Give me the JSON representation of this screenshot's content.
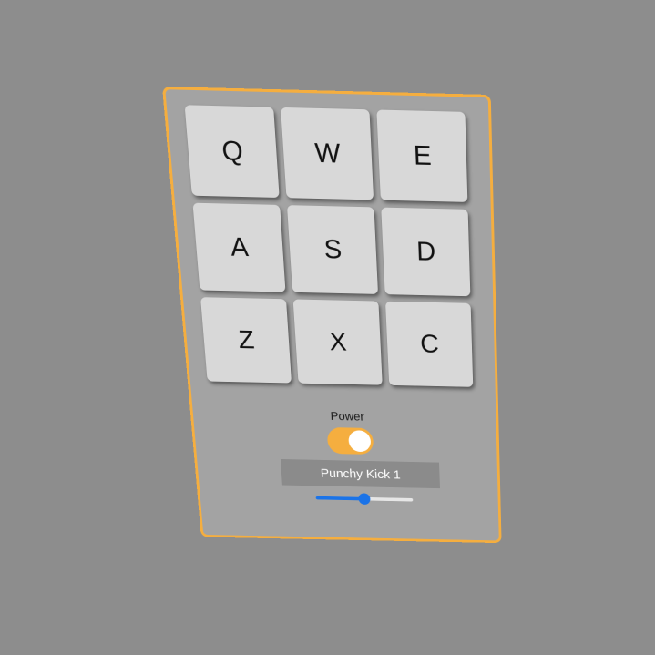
{
  "drum_pads": {
    "keys": [
      {
        "label": "Q"
      },
      {
        "label": "W"
      },
      {
        "label": "E"
      },
      {
        "label": "A"
      },
      {
        "label": "S"
      },
      {
        "label": "D"
      },
      {
        "label": "Z"
      },
      {
        "label": "X"
      },
      {
        "label": "C"
      }
    ]
  },
  "controls": {
    "power_label": "Power",
    "power_on": true,
    "display_text": "Punchy Kick 1",
    "volume_fraction": 0.5
  },
  "colors": {
    "accent": "#f5ae3f",
    "slider": "#1a73e8",
    "pad": "#d8d8d8",
    "background": "#8d8d8d"
  }
}
